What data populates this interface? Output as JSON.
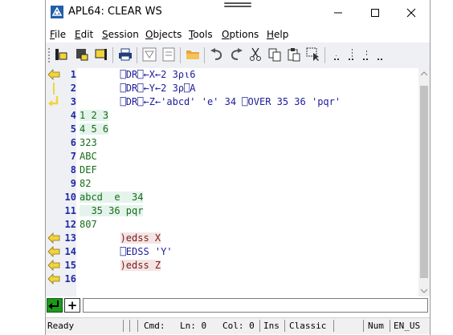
{
  "window": {
    "title": "APL64: CLEAR WS",
    "minimize": "—",
    "maximize": "☐",
    "close": "✕"
  },
  "menu": {
    "file": {
      "u": "F",
      "rest": "ile"
    },
    "edit": {
      "u": "E",
      "rest": "dit"
    },
    "session": {
      "u": "S",
      "rest": "ession"
    },
    "objects": {
      "u": "O",
      "rest": "bjects"
    },
    "tools": {
      "u": "T",
      "rest": "ools"
    },
    "options": {
      "u": "O",
      "rest": "ptions"
    },
    "help": {
      "u": "H",
      "rest": "elp"
    }
  },
  "toolbar_icons": [
    "tie-left-icon",
    "tie-down-icon",
    "tie-right-icon",
    "print-icon",
    "filter-icon",
    "document-icon",
    "folder-icon",
    "undo-icon",
    "redo-icon",
    "cut-icon",
    "copy-icon",
    "paste-icon",
    "select-icon",
    "dotted-1-icon",
    "dotted-2-icon",
    "dotted-3-icon",
    "dotted-4-icon"
  ],
  "lines": [
    {
      "n": "1",
      "text": "       ⎕DR⎕←X←2 3⍴⍳6",
      "kind": "input"
    },
    {
      "n": "2",
      "text": "       ⎕DR⎕←Y←2 3⍴⎕A",
      "kind": "input"
    },
    {
      "n": "3",
      "text": "       ⎕DR⎕←Z←'abcd' 'e' 34 ⎕OVER 35 36 'pqr'",
      "kind": "input"
    },
    {
      "n": "4",
      "text": "1 2 3",
      "kind": "output-hl"
    },
    {
      "n": "5",
      "text": "4 5 6",
      "kind": "output-hl"
    },
    {
      "n": "6",
      "text": "323",
      "kind": "output"
    },
    {
      "n": "7",
      "text": "ABC",
      "kind": "output"
    },
    {
      "n": "8",
      "text": "DEF",
      "kind": "output"
    },
    {
      "n": "9",
      "text": "82",
      "kind": "output"
    },
    {
      "n": "10",
      "text": "abcd  e  34",
      "kind": "output-hl"
    },
    {
      "n": "11",
      "text": "  35 36 pqr",
      "kind": "output-hl"
    },
    {
      "n": "12",
      "text": "807",
      "kind": "output"
    },
    {
      "n": "13",
      "text": "       )edss X",
      "kind": "cmd"
    },
    {
      "n": "14",
      "text": "       ⎕EDSS 'Y'",
      "kind": "input"
    },
    {
      "n": "15",
      "text": "       )edss Z",
      "kind": "cmd"
    },
    {
      "n": "16",
      "text": "",
      "kind": "input"
    }
  ],
  "status": {
    "ready": "Ready",
    "cmd": "Cmd:",
    "ln": "Ln: 0",
    "col": "Col: 0",
    "ins": "Ins",
    "mode": "Classic",
    "num": "Num",
    "locale": "EN_US"
  },
  "input_line": {
    "value": "",
    "add_label": "+"
  },
  "colors": {
    "marker_yellow": "#f2d43a",
    "linenum_blue": "#1e2aa6",
    "output_green": "#1a6b1a",
    "cmd_red": "#7a1a1a"
  }
}
